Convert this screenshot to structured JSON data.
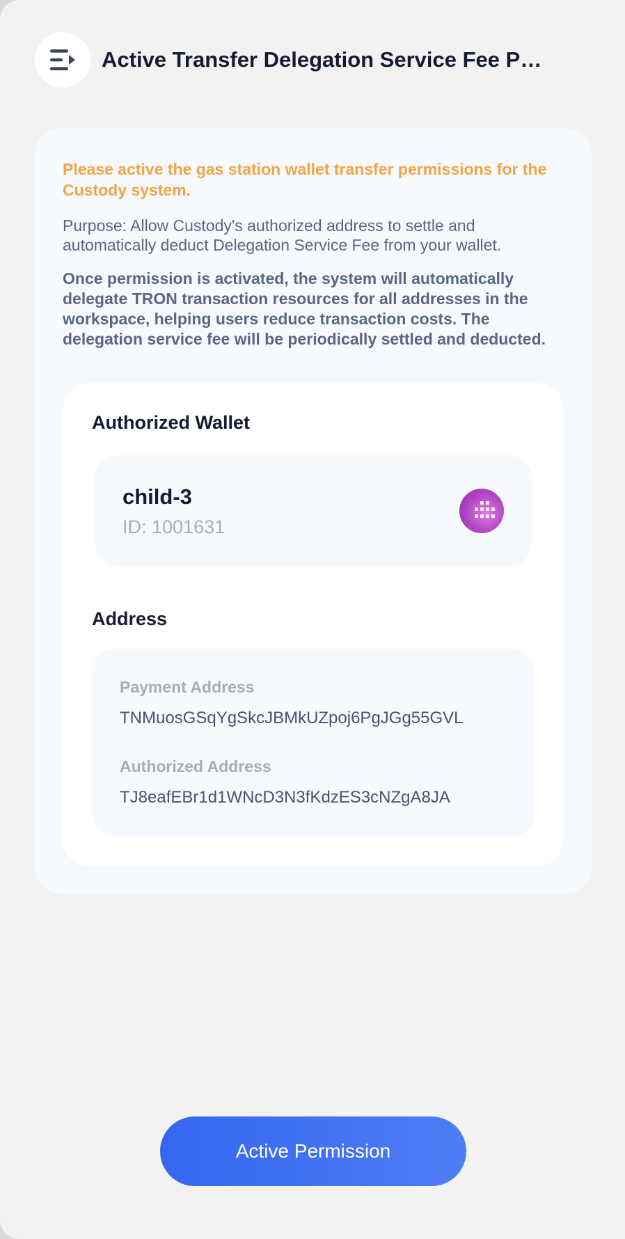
{
  "header": {
    "title": "Active Transfer Delegation Service Fee Per…",
    "menu_icon": "menu-collapse-icon"
  },
  "notice": {
    "warning": "Please active the gas station wallet transfer permissions for the Custody system.",
    "purpose": "Purpose: Allow Custody's authorized address to settle and automatically deduct Delegation Service Fee from your wallet.",
    "info": "Once permission is activated, the system will automatically delegate TRON transaction resources for all addresses in the workspace, helping users reduce transaction costs. The delegation service fee will be periodically settled and deducted."
  },
  "authorized_wallet": {
    "section_title": "Authorized Wallet",
    "name": "child-3",
    "id_text": "ID: 1001631",
    "avatar_icon": "wallet-avatar-icon"
  },
  "address": {
    "section_title": "Address",
    "payment_label": "Payment Address",
    "payment_value": "TNMuosGSqYgSkcJBMkUZpoj6PgJGg55GVL",
    "authorized_label": "Authorized Address",
    "authorized_value": "TJ8eafEBr1d1WNcD3N3fKdzES3cNZgA8JA"
  },
  "actions": {
    "primary_label": "Active Permission"
  },
  "colors": {
    "warning": "#f1a543",
    "primary_start": "#3466f0",
    "primary_end": "#4e7df5",
    "title_text": "#141b33"
  }
}
